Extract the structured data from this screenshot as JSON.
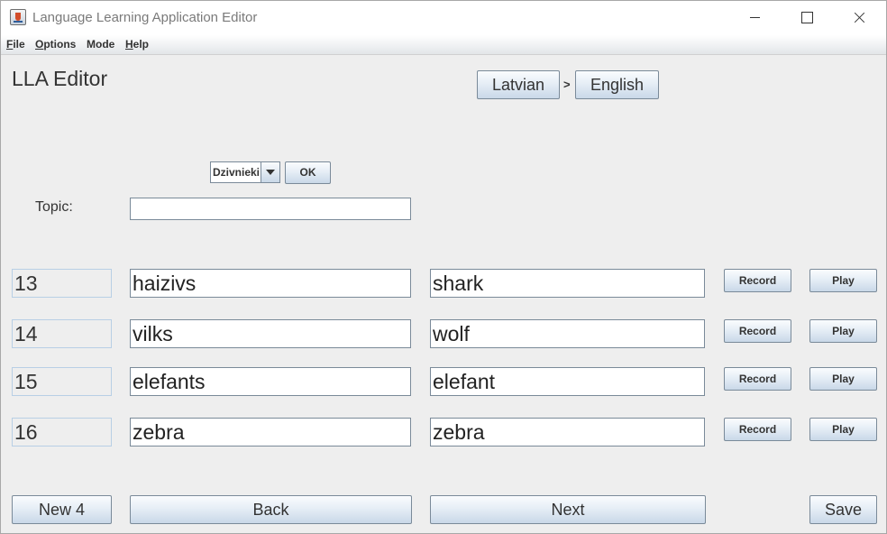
{
  "window": {
    "title": "Language Learning Application Editor"
  },
  "menu": [
    {
      "mnemonic": "F",
      "rest": "ile"
    },
    {
      "mnemonic": "O",
      "rest": "ptions"
    },
    {
      "mnemonic": "",
      "rest": "Mode"
    },
    {
      "mnemonic": "H",
      "rest": "elp"
    }
  ],
  "heading": "LLA Editor",
  "languages": {
    "source": "Latvian",
    "separator": ">",
    "target": "English"
  },
  "topic_select": {
    "selected": "Dzivnieki",
    "ok_label": "OK"
  },
  "topic": {
    "label": "Topic:",
    "value": ""
  },
  "rows": [
    {
      "number": "13",
      "source_word": "haizivs",
      "target_word": "shark",
      "record_label": "Record",
      "play_label": "Play"
    },
    {
      "number": "14",
      "source_word": "vilks",
      "target_word": "wolf",
      "record_label": "Record",
      "play_label": "Play"
    },
    {
      "number": "15",
      "source_word": "elefants",
      "target_word": "elefant",
      "record_label": "Record",
      "play_label": "Play"
    },
    {
      "number": "16",
      "source_word": "zebra",
      "target_word": "zebra",
      "record_label": "Record",
      "play_label": "Play"
    }
  ],
  "footer": {
    "new_label": "New 4",
    "back_label": "Back",
    "next_label": "Next",
    "save_label": "Save"
  }
}
